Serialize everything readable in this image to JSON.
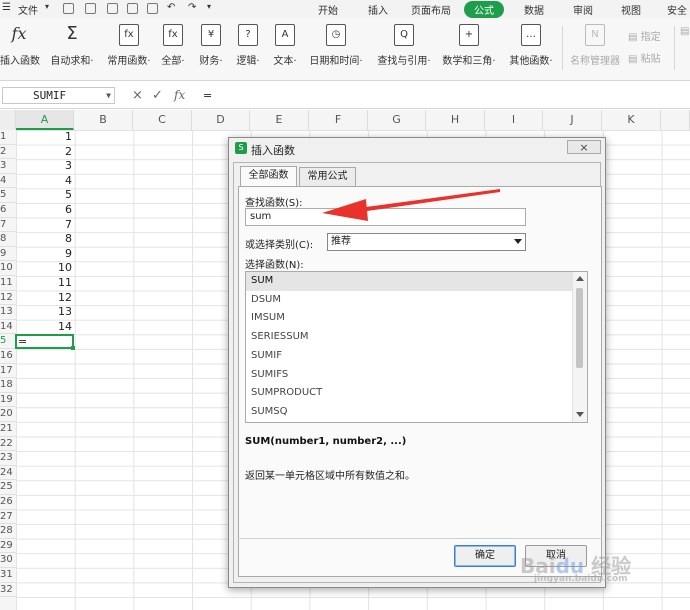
{
  "menubar": {
    "file": "文件",
    "tabs": [
      "开始",
      "插入",
      "页面布局",
      "公式",
      "数据",
      "审阅",
      "视图",
      "安全"
    ],
    "active_tab": "公式"
  },
  "ribbon": {
    "buttons": [
      {
        "label": "插入函数",
        "icon": "fx"
      },
      {
        "label": "自动求和·",
        "icon": "Σ"
      },
      {
        "label": "常用函数·",
        "icon": "fx"
      },
      {
        "label": "全部·",
        "icon": "fx"
      },
      {
        "label": "财务·",
        "icon": "¥"
      },
      {
        "label": "逻辑·",
        "icon": "?"
      },
      {
        "label": "文本·",
        "icon": "A"
      },
      {
        "label": "日期和时间·",
        "icon": "◷"
      },
      {
        "label": "查找与引用·",
        "icon": "Q"
      },
      {
        "label": "数学和三角·",
        "icon": "+"
      },
      {
        "label": "其他函数·",
        "icon": "…"
      },
      {
        "label": "名称管理器",
        "icon": "N"
      }
    ],
    "small_buttons": [
      "指定",
      "粘贴"
    ]
  },
  "formula_bar": {
    "name_box": "SUMIF",
    "cancel_icon": "×",
    "confirm_icon": "✓",
    "fx_icon": "fx",
    "content": "="
  },
  "sheet": {
    "columns": [
      "A",
      "B",
      "C",
      "D",
      "E",
      "F",
      "G",
      "H",
      "I",
      "J",
      "K"
    ],
    "selected_column": "A",
    "row_numbers": [
      "1",
      "2",
      "3",
      "4",
      "5",
      "6",
      "7",
      "8",
      "9",
      "10",
      "11",
      "12",
      "13",
      "14",
      "15",
      "16",
      "17",
      "18",
      "19",
      "20",
      "21",
      "22",
      "23",
      "24",
      "25",
      "26",
      "27",
      "28",
      "29",
      "30",
      "31",
      "32"
    ],
    "selected_row": "15",
    "row15_label": "5",
    "values": [
      "1",
      "2",
      "3",
      "4",
      "5",
      "6",
      "7",
      "8",
      "9",
      "10",
      "11",
      "12",
      "13",
      "14"
    ],
    "active_cell_value": "="
  },
  "dialog": {
    "title": "插入函数",
    "close_label": "×",
    "tabs": [
      "全部函数",
      "常用公式"
    ],
    "active_tab": "全部函数",
    "search_label": "查找函数(S):",
    "search_value": "sum",
    "category_label": "或选择类别(C):",
    "category_value": "推荐",
    "function_list_label": "选择函数(N):",
    "functions": [
      "SUM",
      "DSUM",
      "IMSUM",
      "SERIESSUM",
      "SUMIF",
      "SUMIFS",
      "SUMPRODUCT",
      "SUMSQ"
    ],
    "selected_function": "SUM",
    "syntax": "SUM(number1, number2, ...)",
    "description": "返回某一单元格区域中所有数值之和。",
    "ok_label": "确定",
    "cancel_label": "取消"
  },
  "colors": {
    "accent": "#1e9e4a",
    "annotation_arrow": "#e8322b"
  }
}
